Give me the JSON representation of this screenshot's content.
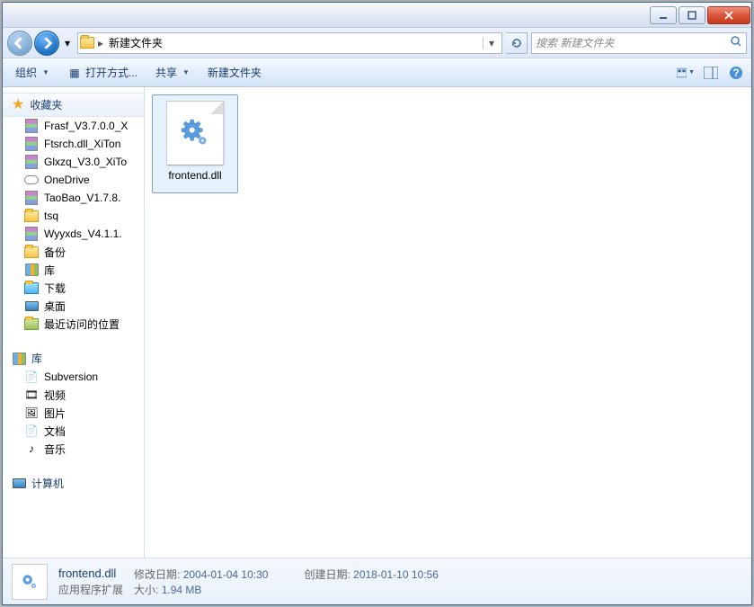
{
  "breadcrumb": {
    "current": "新建文件夹"
  },
  "search": {
    "placeholder": "搜索 新建文件夹"
  },
  "toolbar": {
    "organize": "组织",
    "open_with": "打开方式...",
    "share": "共享",
    "new_folder": "新建文件夹"
  },
  "nav": {
    "favorites": "收藏夹",
    "items_fav": [
      "Frasf_V3.7.0.0_X",
      "Ftsrch.dll_XiTon",
      "Glxzq_V3.0_XiTo",
      "OneDrive",
      "TaoBao_V1.7.8.",
      "tsq",
      "Wyyxds_V4.1.1.",
      "备份",
      "库",
      "下载",
      "桌面",
      "最近访问的位置"
    ],
    "libraries": "库",
    "items_lib": [
      "Subversion",
      "视频",
      "图片",
      "文档",
      "音乐"
    ],
    "computer": "计算机"
  },
  "content": {
    "file_name": "frontend.dll"
  },
  "details": {
    "name": "frontend.dll",
    "type": "应用程序扩展",
    "modified_label": "修改日期:",
    "modified_value": "2004-01-04 10:30",
    "created_label": "创建日期:",
    "created_value": "2018-01-10 10:56",
    "size_label": "大小:",
    "size_value": "1.94 MB"
  }
}
